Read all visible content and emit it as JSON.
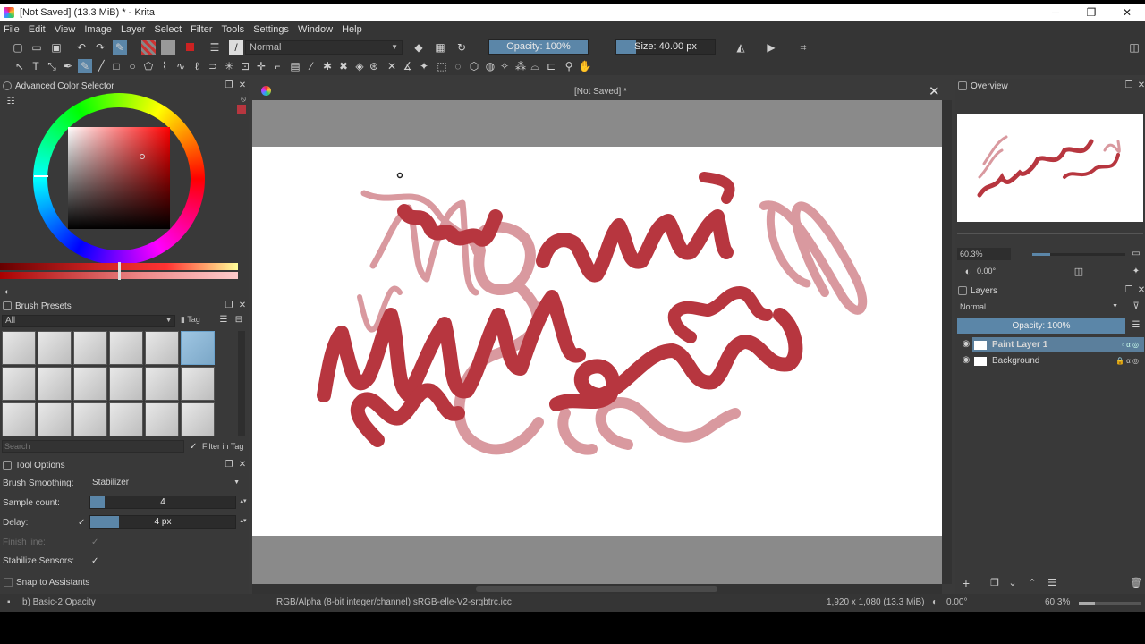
{
  "window": {
    "title": "[Not Saved]  (13.3 MiB)  * - Krita",
    "controls": {
      "minimize": "─",
      "restore": "❐",
      "close": "✕"
    }
  },
  "menu": [
    "File",
    "Edit",
    "View",
    "Image",
    "Layer",
    "Select",
    "Filter",
    "Tools",
    "Settings",
    "Window",
    "Help"
  ],
  "toolbar": {
    "blend_mode": "Normal",
    "opacity_label": "Opacity: 100%",
    "opacity_fraction": 1.0,
    "size_label": "Size: 40.00 px",
    "size_fraction": 0.2
  },
  "color_selector": {
    "title": "Advanced Color Selector",
    "selected_color": "#b7363f"
  },
  "brush_presets": {
    "title": "Brush Presets",
    "filter_value": "All",
    "tag_label": "Tag",
    "search_placeholder": "Search",
    "filter_in_tag": "Filter in Tag"
  },
  "tool_options": {
    "title": "Tool Options",
    "brush_smoothing_label": "Brush Smoothing:",
    "brush_smoothing_value": "Stabilizer",
    "sample_count_label": "Sample count:",
    "sample_count_value": "4",
    "sample_count_fraction": 0.1,
    "delay_label": "Delay:",
    "delay_value": "4 px",
    "delay_fraction": 0.2,
    "finish_line_label": "Finish line:",
    "stabilize_sensors_label": "Stabilize Sensors:",
    "snap_label": "Snap to Assistants",
    "check_mark": "✓"
  },
  "document": {
    "tab_title": "[Not Saved]  *",
    "stroke_color": "#b7363f",
    "faded_color": "#d9999f"
  },
  "overview": {
    "title": "Overview",
    "zoom": "60.3%",
    "rotation": "0.00°"
  },
  "layers": {
    "title": "Layers",
    "blend_mode": "Normal",
    "opacity_label": "Opacity:  100%",
    "items": [
      {
        "name": "Paint Layer 1",
        "selected": true
      },
      {
        "name": "Background",
        "selected": false
      }
    ]
  },
  "status": {
    "brush": "b) Basic-2 Opacity",
    "color_space": "RGB/Alpha (8-bit integer/channel)  sRGB-elle-V2-srgbtrc.icc",
    "dimensions": "1,920 x 1,080 (13.3 MiB)",
    "rotation": "0.00°",
    "zoom": "60.3%"
  }
}
